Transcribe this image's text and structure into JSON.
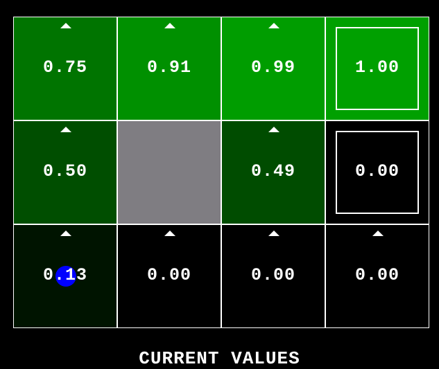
{
  "grid": {
    "rows": [
      [
        {
          "value": "0.75",
          "color": "#007400",
          "arrow": "up",
          "kind": "normal"
        },
        {
          "value": "0.91",
          "color": "#009000",
          "arrow": "up",
          "kind": "normal"
        },
        {
          "value": "0.99",
          "color": "#009d00",
          "arrow": "up",
          "kind": "normal"
        },
        {
          "value": "1.00",
          "color": "#00a000",
          "arrow": "none",
          "kind": "terminal"
        }
      ],
      [
        {
          "value": "0.50",
          "color": "#004e00",
          "arrow": "up",
          "kind": "normal"
        },
        {
          "value": "",
          "color": "#7f7d82",
          "arrow": "none",
          "kind": "wall"
        },
        {
          "value": "0.49",
          "color": "#004c00",
          "arrow": "up",
          "kind": "normal"
        },
        {
          "value": "0.00",
          "color": "#000000",
          "arrow": "none",
          "kind": "terminal"
        }
      ],
      [
        {
          "value": "0.13",
          "color": "#001400",
          "arrow": "up",
          "kind": "agent"
        },
        {
          "value": "0.00",
          "color": "#000000",
          "arrow": "up",
          "kind": "normal"
        },
        {
          "value": "0.00",
          "color": "#000000",
          "arrow": "up",
          "kind": "normal"
        },
        {
          "value": "0.00",
          "color": "#000000",
          "arrow": "up",
          "kind": "normal"
        }
      ]
    ]
  },
  "agent_color": "#0000ff",
  "footer": {
    "label": "CURRENT VALUES"
  }
}
